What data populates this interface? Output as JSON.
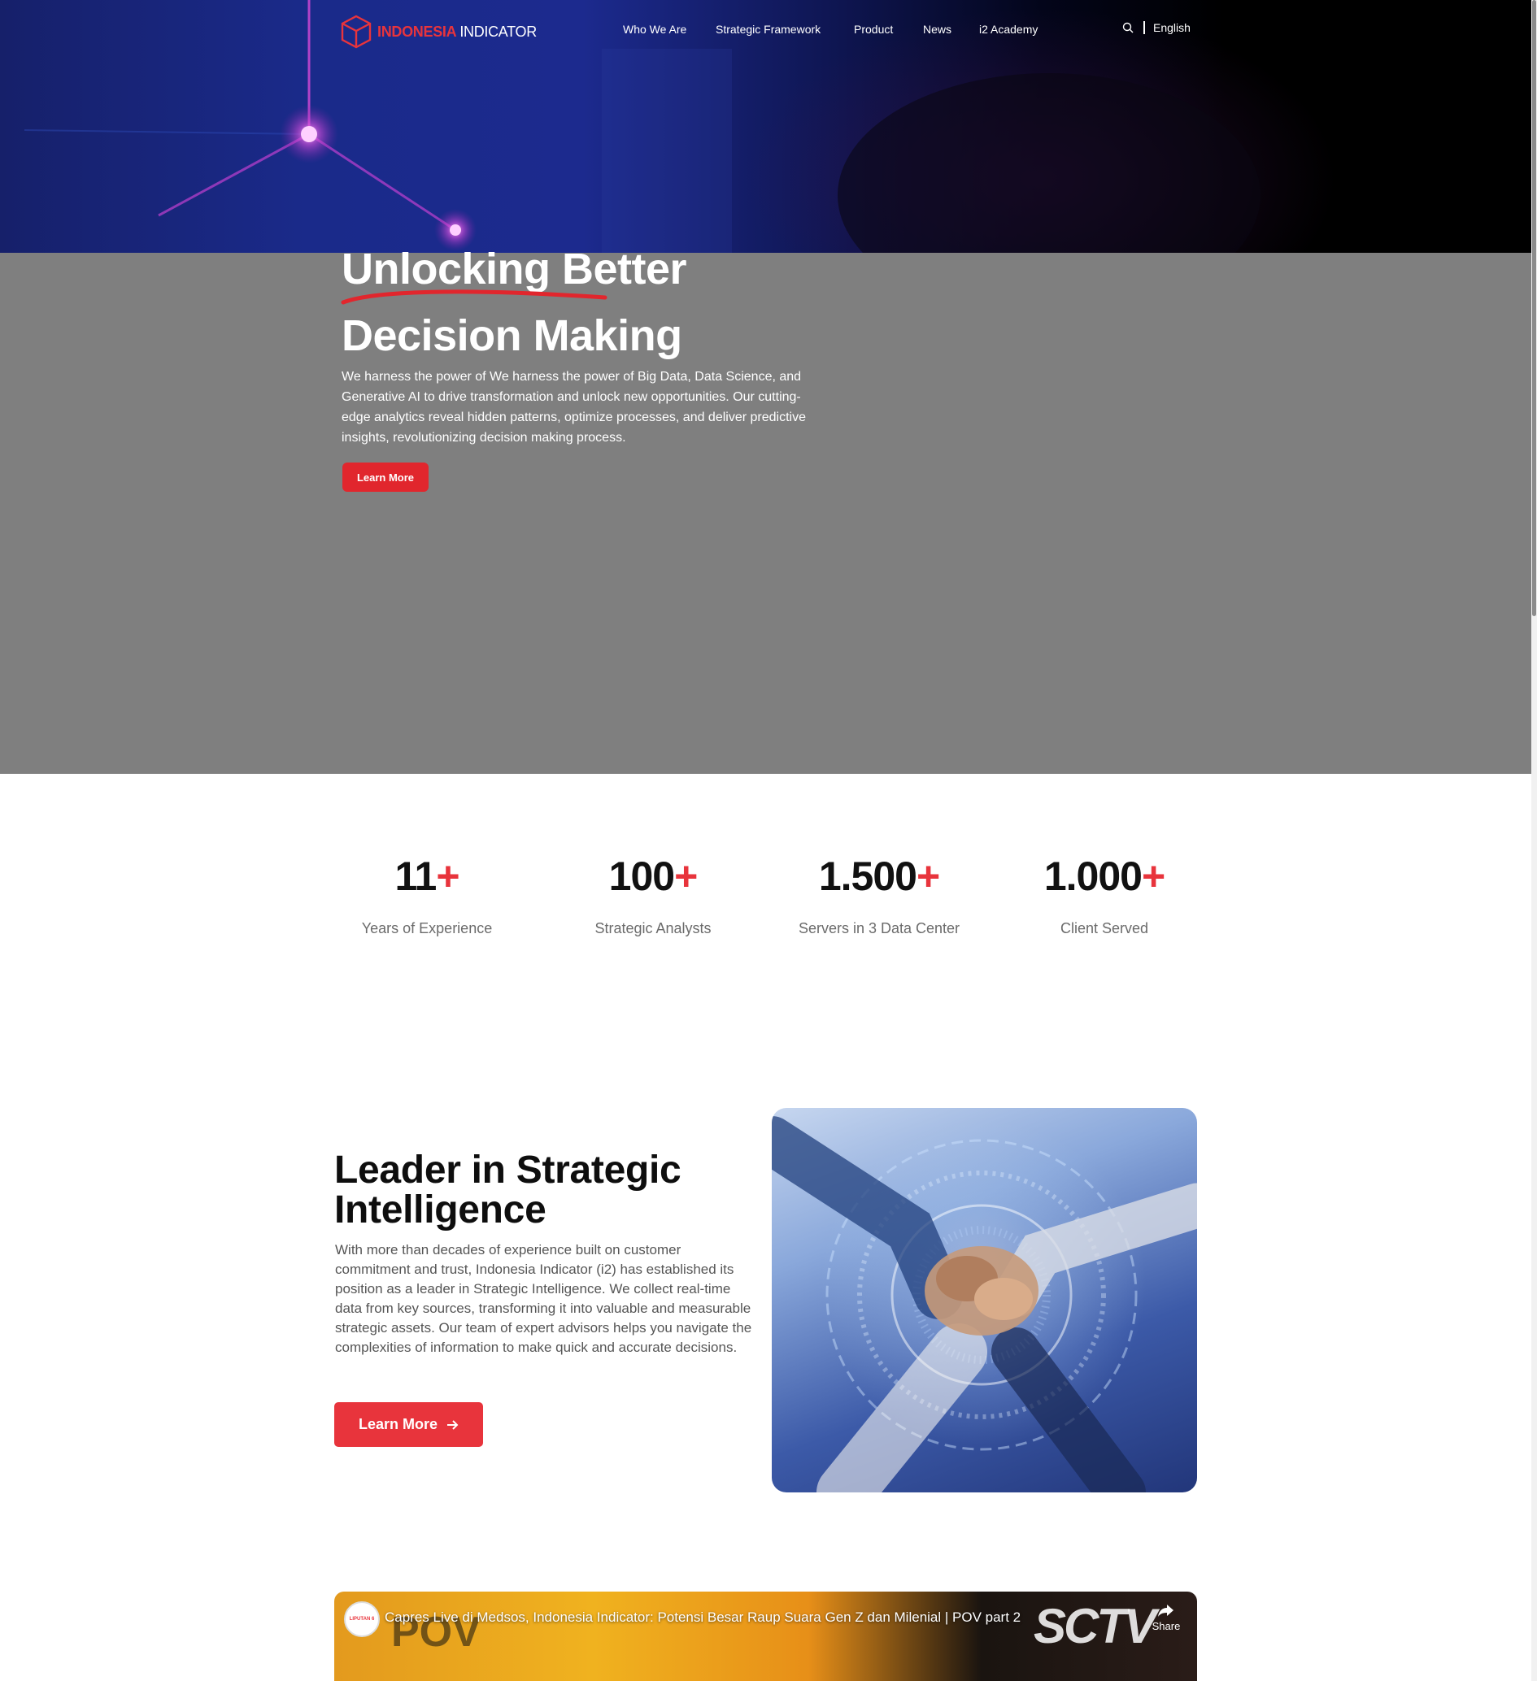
{
  "brand": {
    "name_part1": "INDONESIA",
    "name_part2": "INDICATOR",
    "accent_color": "#e8343c"
  },
  "nav": {
    "items": [
      "Who We Are",
      "Strategic Framework",
      "Product",
      "News",
      "i2 Academy"
    ],
    "language": "English",
    "search_icon": "search-icon"
  },
  "hero": {
    "title_line1": "Unlocking Better",
    "title_line2": "Decision Making",
    "description": "We harness the power of We harness the power of Big Data, Data Science, and Generative AI to drive transformation and unlock new opportunities. Our cutting-edge analytics reveal hidden patterns, optimize processes, and deliver predictive insights, revolutionizing decision making process.",
    "cta_label": "Learn More"
  },
  "stats": [
    {
      "value": "11",
      "suffix": "+",
      "label": "Years of Experience"
    },
    {
      "value": "100",
      "suffix": "+",
      "label": "Strategic Analysts"
    },
    {
      "value": "1.500",
      "suffix": "+",
      "label": "Servers in 3 Data Center"
    },
    {
      "value": "1.000",
      "suffix": "+",
      "label": "Client Served"
    }
  ],
  "leader": {
    "title": "Leader in Strategic Intelligence",
    "description": "With more than decades of experience built on customer commitment and trust, Indonesia Indicator (i2) has established its position as a leader in Strategic Intelligence. We collect real-time data from key sources, transforming it into valuable and measurable strategic assets. Our team of expert advisors helps you navigate the complexities of information to make quick and accurate decisions.",
    "cta_label": "Learn More",
    "cta_icon": "arrow-right-icon"
  },
  "video": {
    "title": "Capres Live di Medsos, Indonesia Indicator: Potensi Besar Raup Suara Gen Z dan Milenial | POV part 2",
    "share_label": "Share",
    "channel_badge": "LIPUTAN 6",
    "overlay_brand": "SCTV",
    "overlay_show": "POV"
  }
}
